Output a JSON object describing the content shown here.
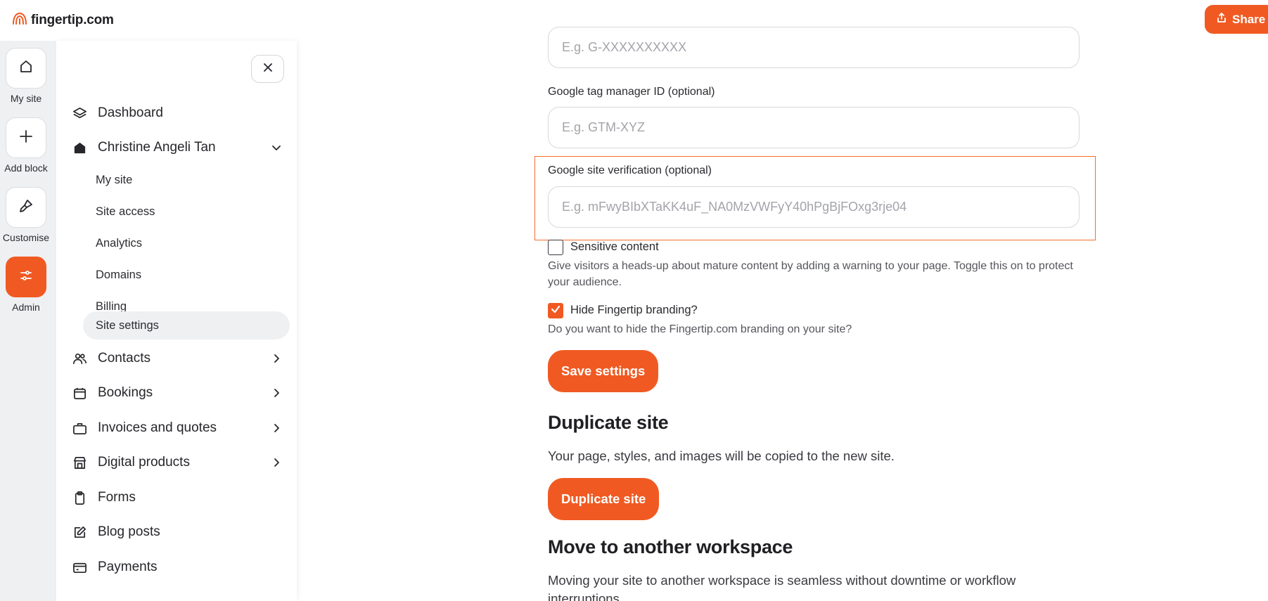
{
  "app": {
    "logo_text": "fingertip.com",
    "share_label": "Share",
    "brand_color": "#f05a22"
  },
  "rail": [
    {
      "label": "My site",
      "icon": "home-icon"
    },
    {
      "label": "Add block",
      "icon": "plus-icon"
    },
    {
      "label": "Customise",
      "icon": "brush-icon"
    },
    {
      "label": "Admin",
      "icon": "sliders-icon"
    }
  ],
  "sidebar": {
    "dashboard": "Dashboard",
    "site_name": "Christine Angeli Tan",
    "sub_items": [
      "My site",
      "Site access",
      "Analytics",
      "Domains",
      "Billing",
      "Site settings"
    ],
    "contacts": "Contacts",
    "bookings": "Bookings",
    "invoices": "Invoices and quotes",
    "digital_products": "Digital products",
    "forms": "Forms",
    "blog_posts": "Blog posts",
    "payments": "Payments"
  },
  "settings": {
    "ga_placeholder": "E.g. G-XXXXXXXXXX",
    "gtm_label": "Google tag manager ID (optional)",
    "gtm_placeholder": "E.g. GTM-XYZ",
    "gsv_label": "Google site verification (optional)",
    "gsv_placeholder": "E.g. mFwyBIbXTaKK4uF_NA0MzVWFyY40hPgBjFOxg3rje04",
    "sensitive_label": "Sensitive content",
    "sensitive_checked": false,
    "sensitive_help": "Give visitors a heads-up about mature content by adding a warning to your page. Toggle this on to protect your audience.",
    "hide_branding_label": "Hide Fingertip branding?",
    "hide_branding_checked": true,
    "hide_branding_help": "Do you want to hide the Fingertip.com branding on your site?",
    "save_label": "Save settings"
  },
  "duplicate": {
    "heading": "Duplicate site",
    "text": "Your page, styles, and images will be copied to the new site.",
    "button": "Duplicate site"
  },
  "move": {
    "heading": "Move to another workspace",
    "text": "Moving your site to another workspace is seamless without downtime or workflow interruptions."
  }
}
